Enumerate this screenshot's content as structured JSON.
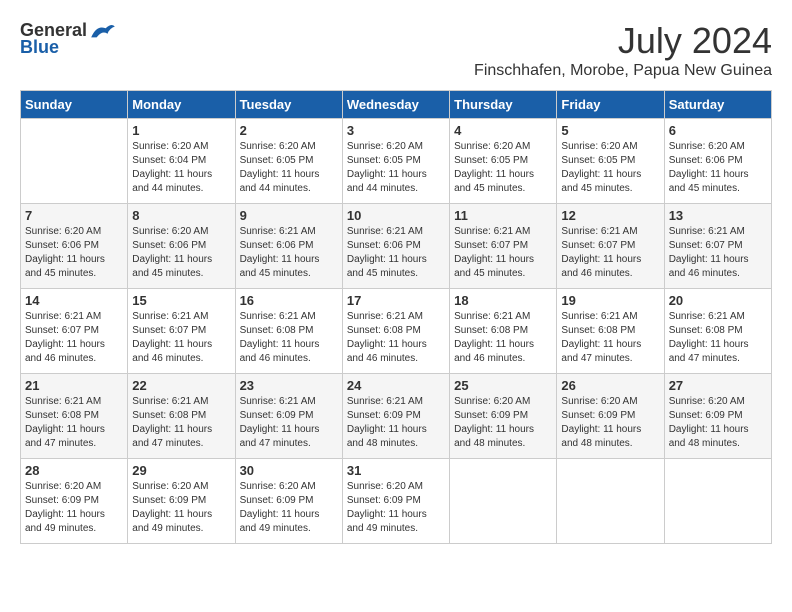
{
  "logo": {
    "general": "General",
    "blue": "Blue"
  },
  "title": {
    "month_year": "July 2024",
    "location": "Finschhafen, Morobe, Papua New Guinea"
  },
  "calendar": {
    "headers": [
      "Sunday",
      "Monday",
      "Tuesday",
      "Wednesday",
      "Thursday",
      "Friday",
      "Saturday"
    ],
    "weeks": [
      [
        {
          "day": "",
          "sunrise": "",
          "sunset": "",
          "daylight": ""
        },
        {
          "day": "1",
          "sunrise": "Sunrise: 6:20 AM",
          "sunset": "Sunset: 6:04 PM",
          "daylight": "Daylight: 11 hours and 44 minutes."
        },
        {
          "day": "2",
          "sunrise": "Sunrise: 6:20 AM",
          "sunset": "Sunset: 6:05 PM",
          "daylight": "Daylight: 11 hours and 44 minutes."
        },
        {
          "day": "3",
          "sunrise": "Sunrise: 6:20 AM",
          "sunset": "Sunset: 6:05 PM",
          "daylight": "Daylight: 11 hours and 44 minutes."
        },
        {
          "day": "4",
          "sunrise": "Sunrise: 6:20 AM",
          "sunset": "Sunset: 6:05 PM",
          "daylight": "Daylight: 11 hours and 45 minutes."
        },
        {
          "day": "5",
          "sunrise": "Sunrise: 6:20 AM",
          "sunset": "Sunset: 6:05 PM",
          "daylight": "Daylight: 11 hours and 45 minutes."
        },
        {
          "day": "6",
          "sunrise": "Sunrise: 6:20 AM",
          "sunset": "Sunset: 6:06 PM",
          "daylight": "Daylight: 11 hours and 45 minutes."
        }
      ],
      [
        {
          "day": "7",
          "sunrise": "Sunrise: 6:20 AM",
          "sunset": "Sunset: 6:06 PM",
          "daylight": "Daylight: 11 hours and 45 minutes."
        },
        {
          "day": "8",
          "sunrise": "Sunrise: 6:20 AM",
          "sunset": "Sunset: 6:06 PM",
          "daylight": "Daylight: 11 hours and 45 minutes."
        },
        {
          "day": "9",
          "sunrise": "Sunrise: 6:21 AM",
          "sunset": "Sunset: 6:06 PM",
          "daylight": "Daylight: 11 hours and 45 minutes."
        },
        {
          "day": "10",
          "sunrise": "Sunrise: 6:21 AM",
          "sunset": "Sunset: 6:06 PM",
          "daylight": "Daylight: 11 hours and 45 minutes."
        },
        {
          "day": "11",
          "sunrise": "Sunrise: 6:21 AM",
          "sunset": "Sunset: 6:07 PM",
          "daylight": "Daylight: 11 hours and 45 minutes."
        },
        {
          "day": "12",
          "sunrise": "Sunrise: 6:21 AM",
          "sunset": "Sunset: 6:07 PM",
          "daylight": "Daylight: 11 hours and 46 minutes."
        },
        {
          "day": "13",
          "sunrise": "Sunrise: 6:21 AM",
          "sunset": "Sunset: 6:07 PM",
          "daylight": "Daylight: 11 hours and 46 minutes."
        }
      ],
      [
        {
          "day": "14",
          "sunrise": "Sunrise: 6:21 AM",
          "sunset": "Sunset: 6:07 PM",
          "daylight": "Daylight: 11 hours and 46 minutes."
        },
        {
          "day": "15",
          "sunrise": "Sunrise: 6:21 AM",
          "sunset": "Sunset: 6:07 PM",
          "daylight": "Daylight: 11 hours and 46 minutes."
        },
        {
          "day": "16",
          "sunrise": "Sunrise: 6:21 AM",
          "sunset": "Sunset: 6:08 PM",
          "daylight": "Daylight: 11 hours and 46 minutes."
        },
        {
          "day": "17",
          "sunrise": "Sunrise: 6:21 AM",
          "sunset": "Sunset: 6:08 PM",
          "daylight": "Daylight: 11 hours and 46 minutes."
        },
        {
          "day": "18",
          "sunrise": "Sunrise: 6:21 AM",
          "sunset": "Sunset: 6:08 PM",
          "daylight": "Daylight: 11 hours and 46 minutes."
        },
        {
          "day": "19",
          "sunrise": "Sunrise: 6:21 AM",
          "sunset": "Sunset: 6:08 PM",
          "daylight": "Daylight: 11 hours and 47 minutes."
        },
        {
          "day": "20",
          "sunrise": "Sunrise: 6:21 AM",
          "sunset": "Sunset: 6:08 PM",
          "daylight": "Daylight: 11 hours and 47 minutes."
        }
      ],
      [
        {
          "day": "21",
          "sunrise": "Sunrise: 6:21 AM",
          "sunset": "Sunset: 6:08 PM",
          "daylight": "Daylight: 11 hours and 47 minutes."
        },
        {
          "day": "22",
          "sunrise": "Sunrise: 6:21 AM",
          "sunset": "Sunset: 6:08 PM",
          "daylight": "Daylight: 11 hours and 47 minutes."
        },
        {
          "day": "23",
          "sunrise": "Sunrise: 6:21 AM",
          "sunset": "Sunset: 6:09 PM",
          "daylight": "Daylight: 11 hours and 47 minutes."
        },
        {
          "day": "24",
          "sunrise": "Sunrise: 6:21 AM",
          "sunset": "Sunset: 6:09 PM",
          "daylight": "Daylight: 11 hours and 48 minutes."
        },
        {
          "day": "25",
          "sunrise": "Sunrise: 6:20 AM",
          "sunset": "Sunset: 6:09 PM",
          "daylight": "Daylight: 11 hours and 48 minutes."
        },
        {
          "day": "26",
          "sunrise": "Sunrise: 6:20 AM",
          "sunset": "Sunset: 6:09 PM",
          "daylight": "Daylight: 11 hours and 48 minutes."
        },
        {
          "day": "27",
          "sunrise": "Sunrise: 6:20 AM",
          "sunset": "Sunset: 6:09 PM",
          "daylight": "Daylight: 11 hours and 48 minutes."
        }
      ],
      [
        {
          "day": "28",
          "sunrise": "Sunrise: 6:20 AM",
          "sunset": "Sunset: 6:09 PM",
          "daylight": "Daylight: 11 hours and 49 minutes."
        },
        {
          "day": "29",
          "sunrise": "Sunrise: 6:20 AM",
          "sunset": "Sunset: 6:09 PM",
          "daylight": "Daylight: 11 hours and 49 minutes."
        },
        {
          "day": "30",
          "sunrise": "Sunrise: 6:20 AM",
          "sunset": "Sunset: 6:09 PM",
          "daylight": "Daylight: 11 hours and 49 minutes."
        },
        {
          "day": "31",
          "sunrise": "Sunrise: 6:20 AM",
          "sunset": "Sunset: 6:09 PM",
          "daylight": "Daylight: 11 hours and 49 minutes."
        },
        {
          "day": "",
          "sunrise": "",
          "sunset": "",
          "daylight": ""
        },
        {
          "day": "",
          "sunrise": "",
          "sunset": "",
          "daylight": ""
        },
        {
          "day": "",
          "sunrise": "",
          "sunset": "",
          "daylight": ""
        }
      ]
    ]
  }
}
